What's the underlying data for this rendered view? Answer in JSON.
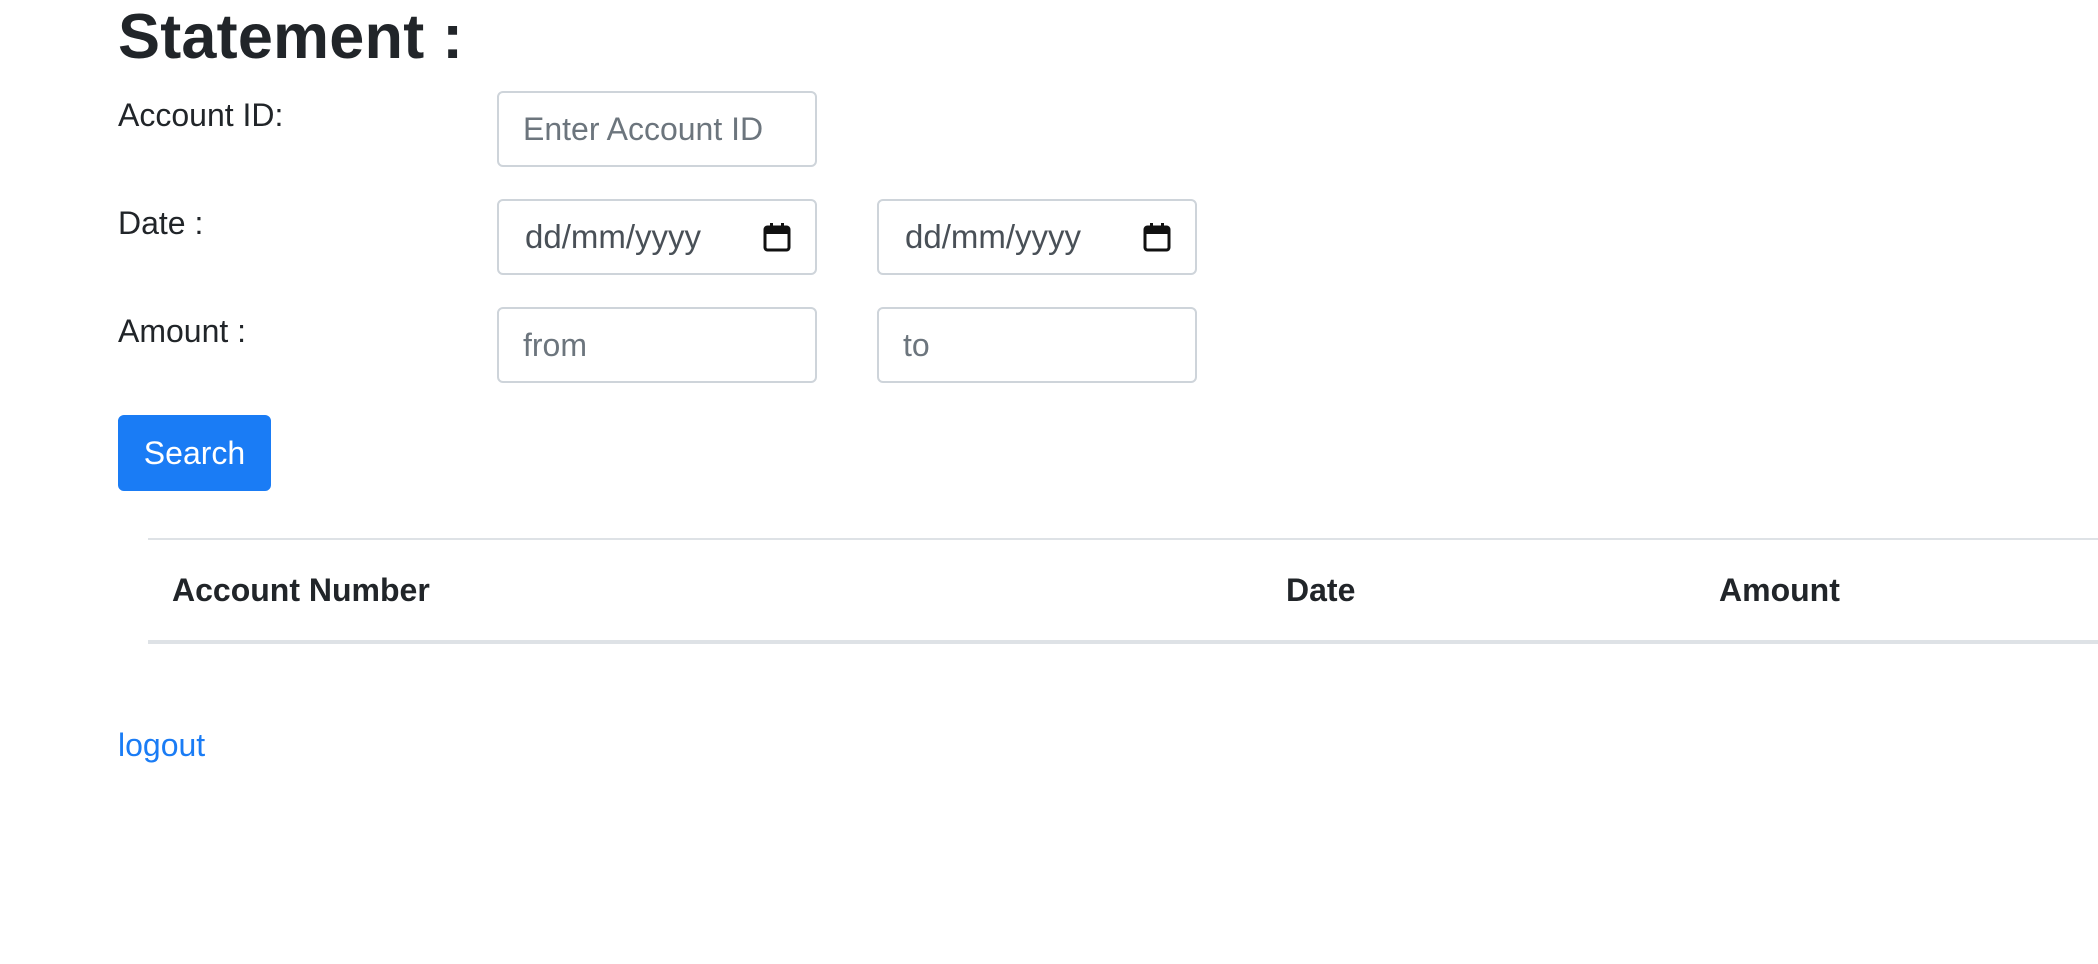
{
  "page": {
    "title": "Statement :"
  },
  "form": {
    "account_label": "Account ID:",
    "account_placeholder": "Enter Account ID",
    "date_label": "Date :",
    "date_from_placeholder": "dd/mm/yyyy",
    "date_to_placeholder": "dd/mm/yyyy",
    "amount_label": "Amount :",
    "amount_from_placeholder": "from",
    "amount_to_placeholder": "to",
    "search_label": "Search"
  },
  "table": {
    "columns": [
      "Account Number",
      "Date",
      "Amount"
    ],
    "rows": []
  },
  "footer": {
    "logout_label": "logout"
  },
  "icons": {
    "date_picker": "calendar-icon"
  },
  "colors": {
    "primary": "#1a7cf5",
    "text": "#212529",
    "border": "#ced4da"
  }
}
